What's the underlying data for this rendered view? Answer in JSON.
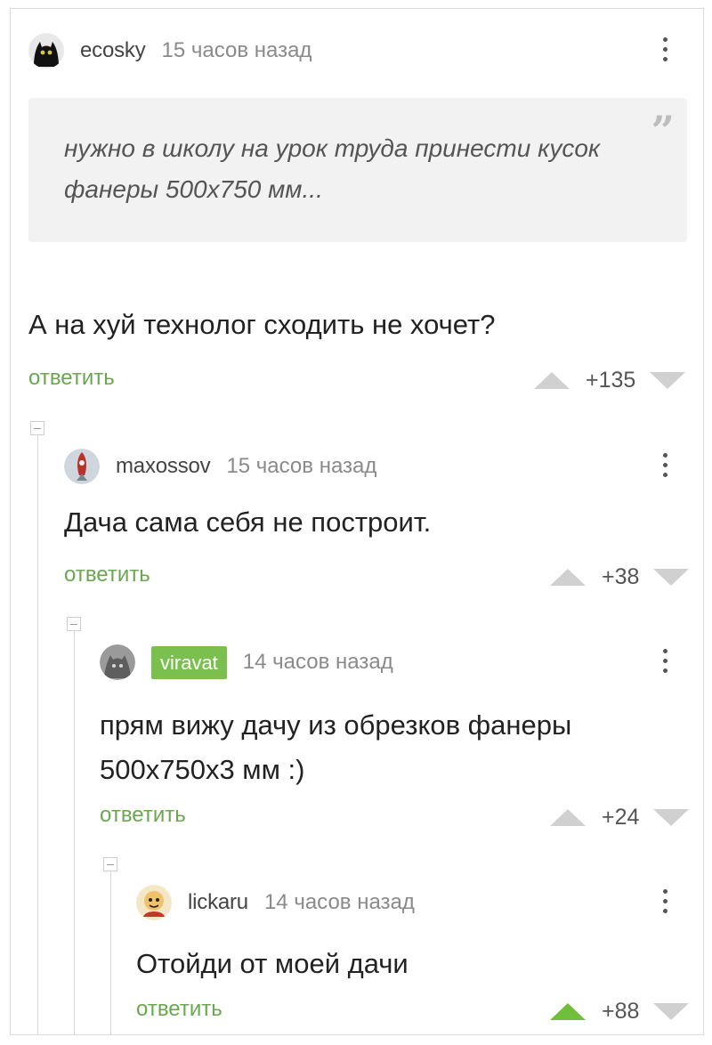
{
  "comments": [
    {
      "author": "ecosky",
      "time": "15 часов назад",
      "quote": "нужно в школу на урок труда принести кусок фанеры 500х750 мм...",
      "text": "А на хуй технолог сходить не хочет?",
      "reply_label": "ответить",
      "score": "+135",
      "avatar_icon": "black-cat-avatar-icon",
      "upvoted": false
    },
    {
      "author": "maxossov",
      "time": "15 часов назад",
      "text": "Дача сама себя не построит.",
      "reply_label": "ответить",
      "score": "+38",
      "avatar_icon": "rocket-avatar-icon",
      "upvoted": false
    },
    {
      "author": "viravat",
      "author_badge_color": "#7bbf4f",
      "time": "14 часов назад",
      "text_lines": [
        "прям вижу дачу из обрезков фанеры",
        "500х750х3 мм :)"
      ],
      "reply_label": "ответить",
      "score": "+24",
      "avatar_icon": "grey-cat-avatar-icon",
      "upvoted": false
    },
    {
      "author": "lickaru",
      "time": "14 часов назад",
      "text": "Отойди от моей дачи",
      "reply_label": "ответить",
      "score": "+88",
      "avatar_icon": "cartoon-avatar-icon",
      "upvoted": true
    }
  ],
  "colors": {
    "accent_green": "#6aa84f",
    "upvote_active": "#6fbf3b",
    "quote_background": "#f2f2f2"
  }
}
